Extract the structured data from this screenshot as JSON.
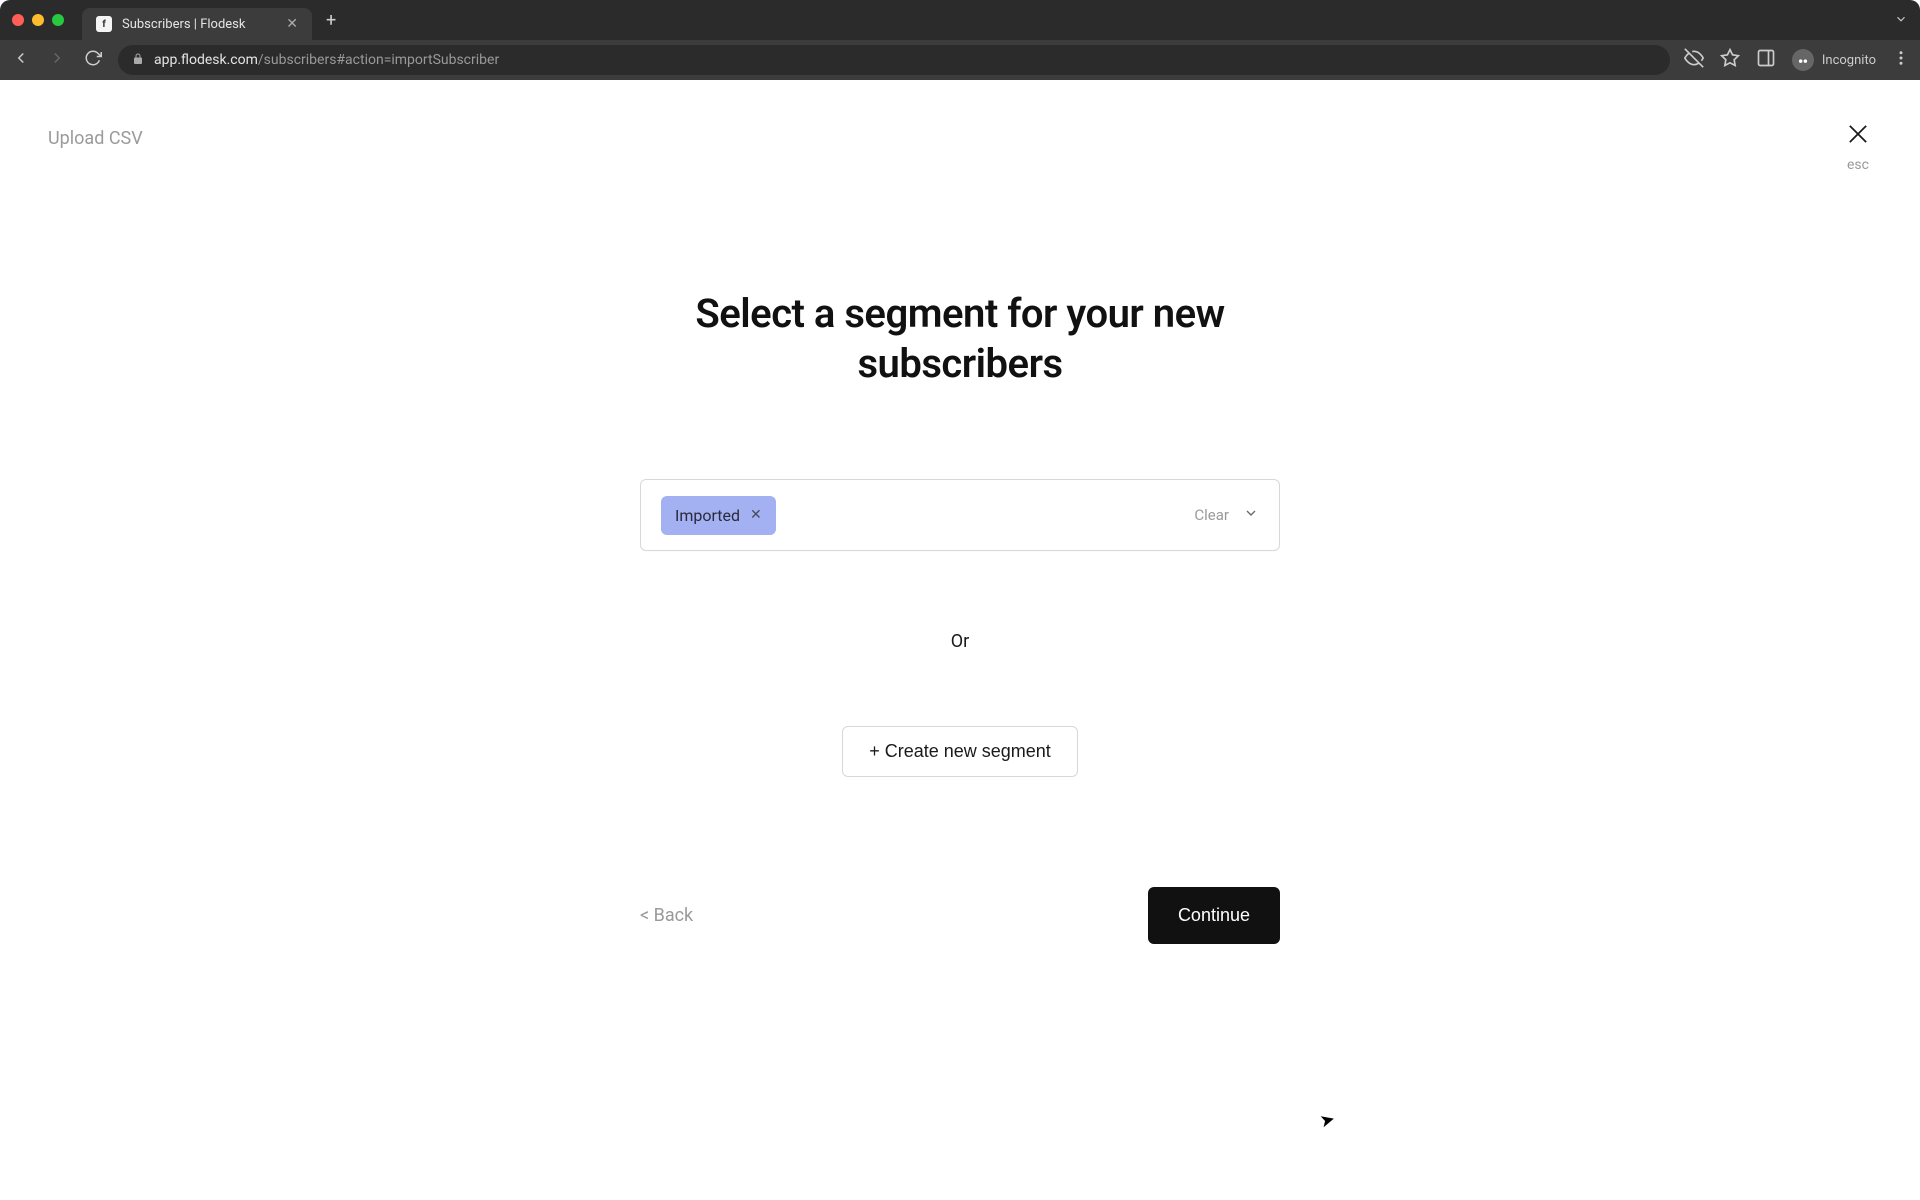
{
  "browser": {
    "tab_title": "Subscribers | Flodesk",
    "url_host": "app.flodesk.com",
    "url_path": "/subscribers#action=importSubscriber",
    "incognito_label": "Incognito"
  },
  "page": {
    "breadcrumb": "Upload CSV",
    "close_hint": "esc",
    "heading": "Select a segment for your new subscribers",
    "selected_segment": "Imported",
    "clear_label": "Clear",
    "or_label": "Or",
    "create_label": "+ Create new segment",
    "back_label": "< Back",
    "continue_label": "Continue"
  }
}
